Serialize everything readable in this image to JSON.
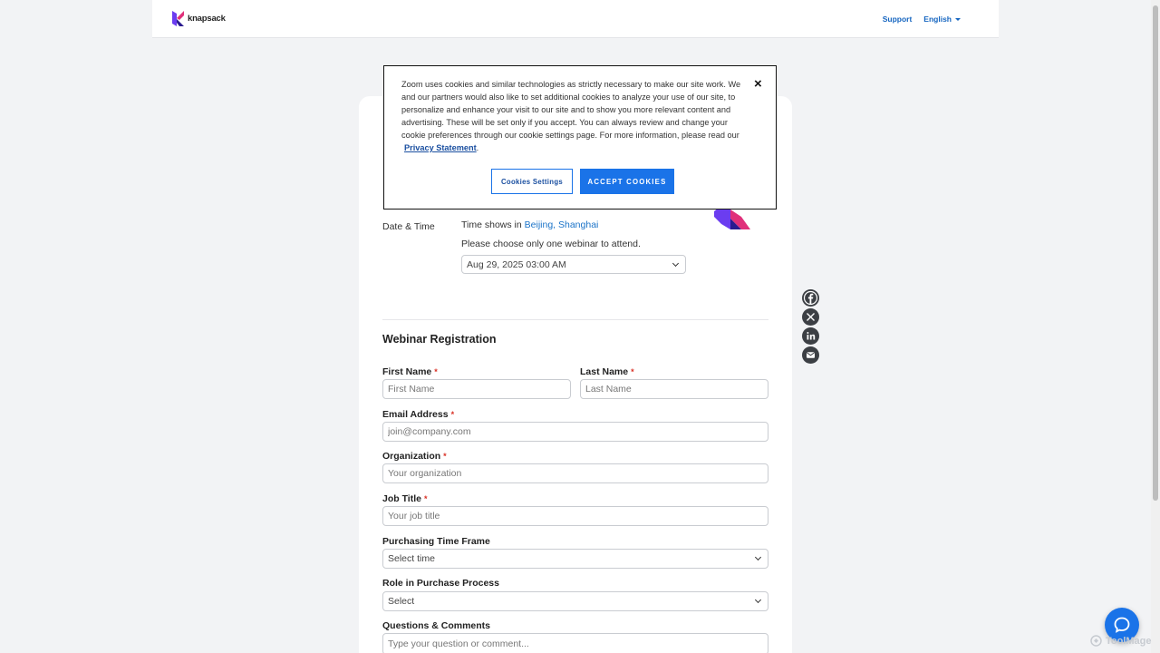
{
  "header": {
    "logo_text": "knapsack",
    "support_label": "Support",
    "language_label": "English"
  },
  "cookie_banner": {
    "text": "Zoom uses cookies and similar technologies as strictly necessary to make our site work. We and our partners would also like to set additional cookies to analyze your use of our site, to personalize and enhance your visit to our site and to show you more relevant content and advertising. These will be set only if you accept. You can always review and change your cookie preferences through our cookie settings page. For more information, please read our",
    "privacy_link": "Privacy Statement",
    "close_symbol": "×",
    "settings_label": "Cookies Settings",
    "accept_label": "ACCEPT COOKIES"
  },
  "datetime": {
    "label": "Date & Time",
    "time_shows_prefix": "Time shows in",
    "timezone": "Beijing, Shanghai",
    "note": "Please choose only one webinar to attend.",
    "selected": "Aug 29, 2025 03:00 AM"
  },
  "form": {
    "title": "Webinar Registration",
    "required_mark": "*",
    "first_name": {
      "label": "First Name",
      "placeholder": "First Name"
    },
    "last_name": {
      "label": "Last Name",
      "placeholder": "Last Name"
    },
    "email": {
      "label": "Email Address",
      "placeholder": "join@company.com"
    },
    "organization": {
      "label": "Organization",
      "placeholder": "Your organization"
    },
    "job_title": {
      "label": "Job Title",
      "placeholder": "Your job title"
    },
    "purchasing_time_frame": {
      "label": "Purchasing Time Frame",
      "value": "Select time"
    },
    "role_in_purchase": {
      "label": "Role in Purchase Process",
      "value": "Select"
    },
    "questions": {
      "label": "Questions & Comments",
      "placeholder": "Type your question or comment..."
    }
  },
  "social_icons": [
    "facebook-icon",
    "x-icon",
    "linkedin-icon",
    "email-icon"
  ],
  "watermark": "ToolMage",
  "colors": {
    "link_blue": "#1a73c8",
    "accept_blue": "#1a73e8",
    "required_red": "#d93025",
    "page_bg": "#f2f3f5"
  }
}
